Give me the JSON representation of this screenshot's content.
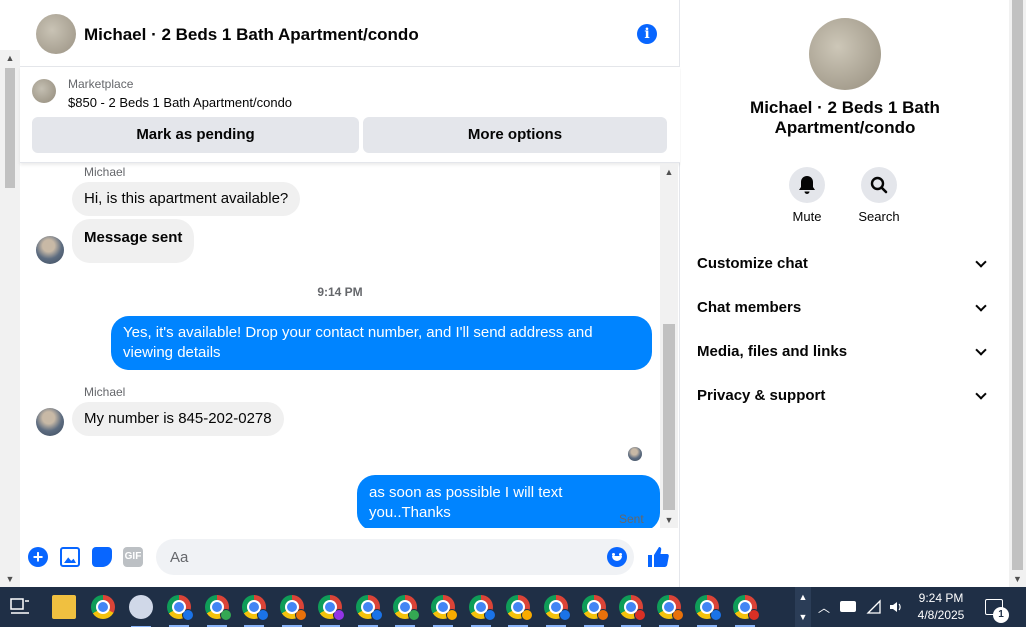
{
  "chat": {
    "title": "Michael · 2 Beds 1 Bath Apartment/condo",
    "info_icon": "info-icon"
  },
  "listing": {
    "source": "Marketplace",
    "summary": "$850 - 2 Beds 1 Bath Apartment/condo",
    "mark_pending_label": "Mark as pending",
    "more_options_label": "More options"
  },
  "messages": [
    {
      "sender": "Michael",
      "text": "Hi, is this apartment available?",
      "direction": "in"
    },
    {
      "text": "Message sent",
      "direction": "in"
    },
    {
      "timestamp": "9:14 PM"
    },
    {
      "text": "Yes, it's available! Drop your contact number, and I'll send address and viewing details",
      "direction": "out"
    },
    {
      "sender": "Michael",
      "text": "My number is 845-202-0278",
      "direction": "in"
    },
    {
      "text": "as soon as possible I will text you..Thanks",
      "direction": "out",
      "status": "Sent"
    }
  ],
  "composer": {
    "placeholder": "Aa",
    "icons": [
      "plus-icon",
      "photo-icon",
      "sticker-icon",
      "gif-icon",
      "emoji-icon",
      "like-icon"
    ],
    "gif_label": "GIF"
  },
  "side": {
    "name": "Michael · 2 Beds 1 Bath Apartment/condo",
    "actions": [
      {
        "label": "Mute",
        "icon": "bell-icon"
      },
      {
        "label": "Search",
        "icon": "search-icon"
      }
    ],
    "sections": [
      "Customize chat",
      "Chat members",
      "Media, files and links",
      "Privacy & support"
    ]
  },
  "taskbar": {
    "time": "9:24 PM",
    "date": "4/8/2025",
    "notification_count": "1",
    "profile_colors": [
      "#1a73e8",
      "#34a853",
      "#1a73e8",
      "#e8710a",
      "#9334e6",
      "#1a73e8",
      "#34a853",
      "#f9ab00",
      "#1a73e8",
      "#f9ab00",
      "#1a73e8",
      "#e8710a",
      "#d93025",
      "#e8710a",
      "#1a73e8",
      "#d93025"
    ]
  },
  "colors": {
    "accent": "#0866ff",
    "outgoing_bubble": "#0084ff",
    "incoming_bubble": "#f0f0f0",
    "taskbar": "#1f2f46"
  }
}
